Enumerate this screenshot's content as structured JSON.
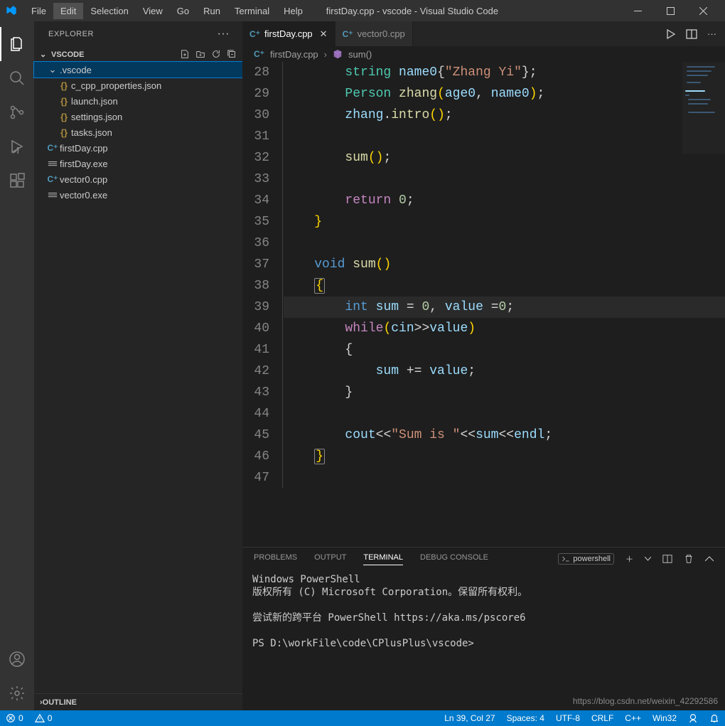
{
  "window": {
    "title": "firstDay.cpp - vscode - Visual Studio Code"
  },
  "menu": {
    "items": [
      "File",
      "Edit",
      "Selection",
      "View",
      "Go",
      "Run",
      "Terminal",
      "Help"
    ],
    "hover_index": 1
  },
  "activitybar": {
    "active_index": 0
  },
  "explorer": {
    "title": "EXPLORER",
    "root": "VSCODE",
    "folder": {
      "name": ".vscode",
      "files": [
        "c_cpp_properties.json",
        "launch.json",
        "settings.json",
        "tasks.json"
      ]
    },
    "files": [
      {
        "name": "firstDay.cpp",
        "type": "cpp"
      },
      {
        "name": "firstDay.exe",
        "type": "exe"
      },
      {
        "name": "vector0.cpp",
        "type": "cpp"
      },
      {
        "name": "vector0.exe",
        "type": "exe"
      }
    ],
    "outline_label": "OUTLINE"
  },
  "tabs": [
    {
      "label": "firstDay.cpp",
      "active": true,
      "dirty": false
    },
    {
      "label": "vector0.cpp",
      "active": false,
      "dirty": false
    }
  ],
  "breadcrumbs": {
    "file": "firstDay.cpp",
    "symbol": "sum()"
  },
  "code": {
    "first_line": 28,
    "current_line": 39,
    "lines": [
      [
        {
          "t": "        ",
          "c": "punc"
        },
        {
          "t": "string",
          "c": "type"
        },
        {
          "t": " ",
          "c": "punc"
        },
        {
          "t": "name0",
          "c": "var"
        },
        {
          "t": "{",
          "c": "punc"
        },
        {
          "t": "\"Zhang Yi\"",
          "c": "str"
        },
        {
          "t": "};",
          "c": "punc"
        }
      ],
      [
        {
          "t": "        ",
          "c": "punc"
        },
        {
          "t": "Person",
          "c": "type"
        },
        {
          "t": " ",
          "c": "punc"
        },
        {
          "t": "zhang",
          "c": "fn"
        },
        {
          "t": "(",
          "c": "bracey"
        },
        {
          "t": "age0",
          "c": "var"
        },
        {
          "t": ", ",
          "c": "punc"
        },
        {
          "t": "name0",
          "c": "var"
        },
        {
          "t": ")",
          "c": "bracey"
        },
        {
          "t": ";",
          "c": "punc"
        }
      ],
      [
        {
          "t": "        ",
          "c": "punc"
        },
        {
          "t": "zhang",
          "c": "var"
        },
        {
          "t": ".",
          "c": "punc"
        },
        {
          "t": "intro",
          "c": "fn"
        },
        {
          "t": "()",
          "c": "bracey"
        },
        {
          "t": ";",
          "c": "punc"
        }
      ],
      [],
      [
        {
          "t": "        ",
          "c": "punc"
        },
        {
          "t": "sum",
          "c": "fn"
        },
        {
          "t": "()",
          "c": "bracey"
        },
        {
          "t": ";",
          "c": "punc"
        }
      ],
      [],
      [
        {
          "t": "        ",
          "c": "punc"
        },
        {
          "t": "return",
          "c": "ctl"
        },
        {
          "t": " ",
          "c": "punc"
        },
        {
          "t": "0",
          "c": "num"
        },
        {
          "t": ";",
          "c": "punc"
        }
      ],
      [
        {
          "t": "    ",
          "c": "punc"
        },
        {
          "t": "}",
          "c": "bracey"
        }
      ],
      [],
      [
        {
          "t": "    ",
          "c": "punc"
        },
        {
          "t": "void",
          "c": "kw"
        },
        {
          "t": " ",
          "c": "punc"
        },
        {
          "t": "sum",
          "c": "fn"
        },
        {
          "t": "()",
          "c": "bracey"
        }
      ],
      [
        {
          "t": "    ",
          "c": "punc"
        },
        {
          "t": "{",
          "c": "bracey",
          "match": true
        }
      ],
      [
        {
          "t": "        ",
          "c": "punc"
        },
        {
          "t": "int",
          "c": "kw"
        },
        {
          "t": " ",
          "c": "punc"
        },
        {
          "t": "sum",
          "c": "var"
        },
        {
          "t": " = ",
          "c": "punc"
        },
        {
          "t": "0",
          "c": "num"
        },
        {
          "t": ", ",
          "c": "punc"
        },
        {
          "t": "value",
          "c": "var"
        },
        {
          "t": " =",
          "c": "punc"
        },
        {
          "t": "0",
          "c": "num"
        },
        {
          "t": ";",
          "c": "punc"
        }
      ],
      [
        {
          "t": "        ",
          "c": "punc"
        },
        {
          "t": "while",
          "c": "ctl"
        },
        {
          "t": "(",
          "c": "bracey"
        },
        {
          "t": "cin",
          "c": "var"
        },
        {
          "t": ">>",
          "c": "punc"
        },
        {
          "t": "value",
          "c": "var"
        },
        {
          "t": ")",
          "c": "bracey"
        }
      ],
      [
        {
          "t": "        {",
          "c": "punc"
        }
      ],
      [
        {
          "t": "            ",
          "c": "punc"
        },
        {
          "t": "sum",
          "c": "var"
        },
        {
          "t": " += ",
          "c": "punc"
        },
        {
          "t": "value",
          "c": "var"
        },
        {
          "t": ";",
          "c": "punc"
        }
      ],
      [
        {
          "t": "        }",
          "c": "punc"
        }
      ],
      [],
      [
        {
          "t": "        ",
          "c": "punc"
        },
        {
          "t": "cout",
          "c": "var"
        },
        {
          "t": "<<",
          "c": "punc"
        },
        {
          "t": "\"Sum is \"",
          "c": "str"
        },
        {
          "t": "<<",
          "c": "punc"
        },
        {
          "t": "sum",
          "c": "var"
        },
        {
          "t": "<<",
          "c": "punc"
        },
        {
          "t": "endl",
          "c": "var"
        },
        {
          "t": ";",
          "c": "punc"
        }
      ],
      [
        {
          "t": "    ",
          "c": "punc"
        },
        {
          "t": "}",
          "c": "bracey",
          "match": true
        }
      ],
      []
    ]
  },
  "panel": {
    "tabs": [
      "PROBLEMS",
      "OUTPUT",
      "TERMINAL",
      "DEBUG CONSOLE"
    ],
    "active_index": 2,
    "shell_name": "powershell",
    "terminal_text": "Windows PowerShell\n版权所有 (C) Microsoft Corporation。保留所有权利。\n\n尝试新的跨平台 PowerShell https://aka.ms/pscore6\n\nPS D:\\workFile\\code\\CPlusPlus\\vscode>"
  },
  "statusbar": {
    "errors": "0",
    "warnings": "0",
    "cursor": "Ln 39, Col 27",
    "spaces": "Spaces: 4",
    "encoding": "UTF-8",
    "eol": "CRLF",
    "lang": "C++",
    "platform": "Win32"
  },
  "watermark": "https://blog.csdn.net/weixin_42292586"
}
